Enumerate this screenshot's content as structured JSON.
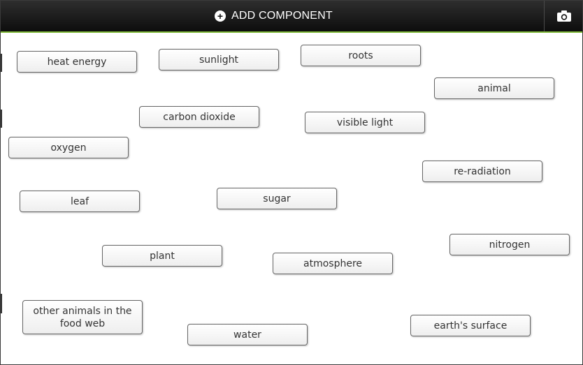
{
  "toolbar": {
    "add_label": "ADD COMPONENT",
    "add_icon": "plus-circle-icon",
    "camera_icon": "camera-icon",
    "accent_color": "#7fb93a"
  },
  "nodes": [
    {
      "label": "heat energy"
    },
    {
      "label": "sunlight"
    },
    {
      "label": "roots"
    },
    {
      "label": "animal"
    },
    {
      "label": "carbon dioxide"
    },
    {
      "label": "visible light"
    },
    {
      "label": "oxygen"
    },
    {
      "label": "re-radiation"
    },
    {
      "label": "leaf"
    },
    {
      "label": "sugar"
    },
    {
      "label": "nitrogen"
    },
    {
      "label": "plant"
    },
    {
      "label": "atmosphere"
    },
    {
      "label": "other animals in the food web"
    },
    {
      "label": "water"
    },
    {
      "label": "earth's surface"
    }
  ]
}
